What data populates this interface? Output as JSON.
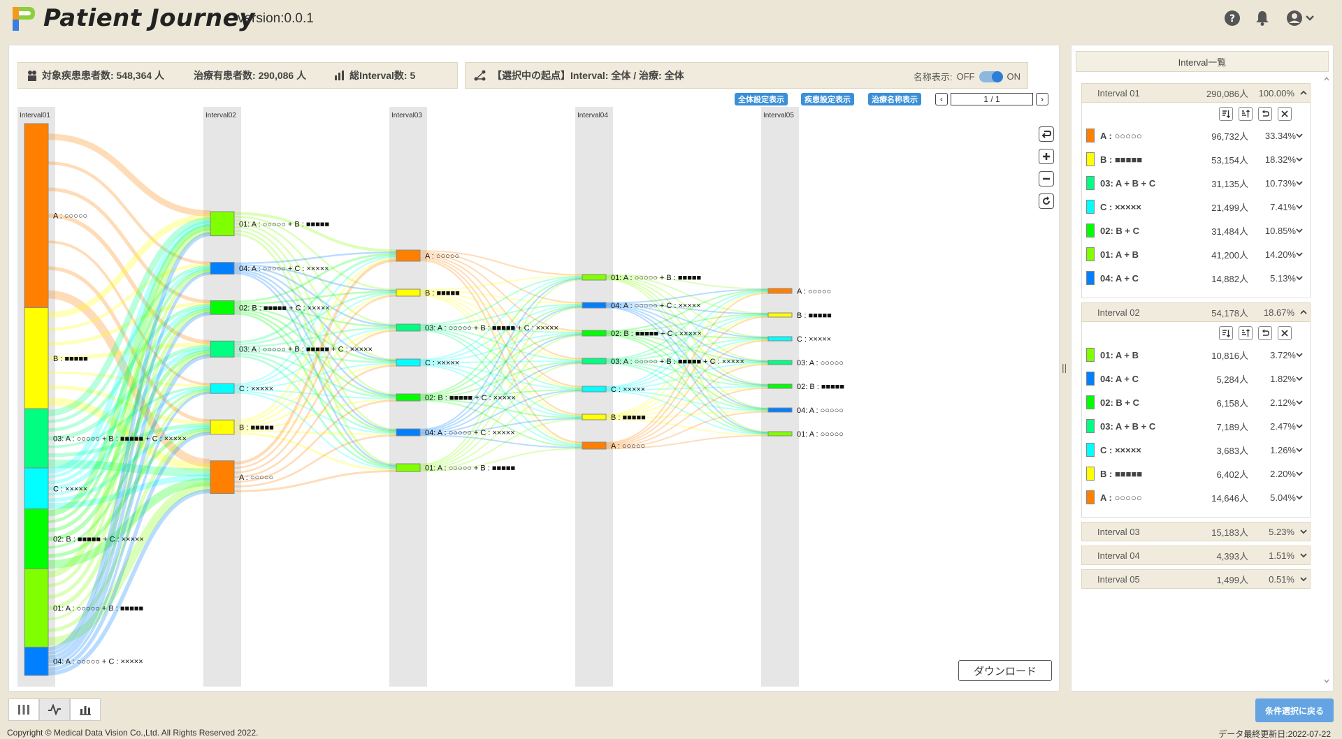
{
  "header": {
    "title": "Patient Journey",
    "version": "version:0.0.1"
  },
  "stats": {
    "target_patients": "対象疾患患者数: 548,364 人",
    "treated_patients": "治療有患者数: 290,086 人",
    "total_intervals": "総Interval数: 5"
  },
  "origin": {
    "text": "【選択中の起点】Interval: 全体 / 治療: 全体",
    "name_display_label": "名称表示:",
    "off_label": "OFF",
    "on_label": "ON"
  },
  "toolbar": {
    "overall_settings": "全体設定表示",
    "disease_settings": "疾患設定表示",
    "treatment_names": "治療名称表示",
    "page": "1 / 1",
    "download": "ダウンロード"
  },
  "colors": {
    "A": "#ff8000",
    "B": "#ffff00",
    "ABC": "#00ff80",
    "C": "#00ffff",
    "BC": "#00ff00",
    "AB": "#80ff00",
    "AC": "#0080ff"
  },
  "sankey": {
    "columns": [
      "Interval01",
      "Interval02",
      "Interval03",
      "Interval04",
      "Interval05"
    ],
    "columns_nodes": [
      [
        {
          "key": "A",
          "label": "A : ○○○○○"
        },
        {
          "key": "B",
          "label": "B : ■■■■■"
        },
        {
          "key": "ABC",
          "label": "03: A : ○○○○○ + B : ■■■■■ + C : ×××××"
        },
        {
          "key": "C",
          "label": "C : ×××××"
        },
        {
          "key": "BC",
          "label": "02: B : ■■■■■ + C : ×××××"
        },
        {
          "key": "AB",
          "label": "01: A : ○○○○○ + B : ■■■■■"
        },
        {
          "key": "AC",
          "label": "04: A : ○○○○○ + C : ×××××"
        }
      ],
      [
        {
          "key": "AB",
          "label": "01: A : ○○○○○ + B : ■■■■■"
        },
        {
          "key": "AC",
          "label": "04: A : ○○○○○ + C : ×××××"
        },
        {
          "key": "BC",
          "label": "02: B : ■■■■■ + C : ×××××"
        },
        {
          "key": "ABC",
          "label": "03: A : ○○○○○ + B : ■■■■■ + C : ×××××"
        },
        {
          "key": "C",
          "label": "C : ×××××"
        },
        {
          "key": "B",
          "label": "B : ■■■■■"
        },
        {
          "key": "A",
          "label": "A : ○○○○○"
        }
      ],
      [
        {
          "key": "A",
          "label": "A : ○○○○○"
        },
        {
          "key": "B",
          "label": "B : ■■■■■"
        },
        {
          "key": "ABC",
          "label": "03: A : ○○○○○ + B : ■■■■■ + C : ×××××"
        },
        {
          "key": "C",
          "label": "C : ×××××"
        },
        {
          "key": "BC",
          "label": "02: B : ■■■■■ + C : ×××××"
        },
        {
          "key": "AC",
          "label": "04: A : ○○○○○ + C : ×××××"
        },
        {
          "key": "AB",
          "label": "01: A : ○○○○○ + B : ■■■■■"
        }
      ],
      [
        {
          "key": "AB",
          "label": "01: A : ○○○○○ + B : ■■■■■"
        },
        {
          "key": "AC",
          "label": "04: A : ○○○○○ + C : ×××××"
        },
        {
          "key": "BC",
          "label": "02: B : ■■■■■ + C : ×××××"
        },
        {
          "key": "ABC",
          "label": "03: A : ○○○○○ + B : ■■■■■ + C : ×××××"
        },
        {
          "key": "C",
          "label": "C : ×××××"
        },
        {
          "key": "B",
          "label": "B : ■■■■■"
        },
        {
          "key": "A",
          "label": "A : ○○○○○"
        }
      ],
      [
        {
          "key": "A",
          "label": "A : ○○○○○"
        },
        {
          "key": "B",
          "label": "B : ■■■■■"
        },
        {
          "key": "C",
          "label": "C : ×××××"
        },
        {
          "key": "ABC",
          "label": "03: A : ○○○○○"
        },
        {
          "key": "BC",
          "label": "02: B : ■■■■■"
        },
        {
          "key": "AC",
          "label": "04: A : ○○○○○"
        },
        {
          "key": "AB",
          "label": "01: A : ○○○○○"
        }
      ]
    ]
  },
  "right_panel": {
    "title": "Interval一覧",
    "intervals": [
      {
        "name": "Interval 01",
        "count": "290,086人",
        "pct": "100.00%",
        "expanded": true,
        "rows": [
          {
            "key": "A",
            "label": "A : ○○○○○",
            "count": "96,732人",
            "pct": "33.34%"
          },
          {
            "key": "B",
            "label": "B : ■■■■■",
            "count": "53,154人",
            "pct": "18.32%"
          },
          {
            "key": "ABC",
            "label": "03: A + B + C",
            "count": "31,135人",
            "pct": "10.73%"
          },
          {
            "key": "C",
            "label": "C : ×××××",
            "count": "21,499人",
            "pct": "7.41%"
          },
          {
            "key": "BC",
            "label": "02: B + C",
            "count": "31,484人",
            "pct": "10.85%"
          },
          {
            "key": "AB",
            "label": "01: A + B",
            "count": "41,200人",
            "pct": "14.20%"
          },
          {
            "key": "AC",
            "label": "04: A + C",
            "count": "14,882人",
            "pct": "5.13%"
          }
        ]
      },
      {
        "name": "Interval 02",
        "count": "54,178人",
        "pct": "18.67%",
        "expanded": true,
        "rows": [
          {
            "key": "AB",
            "label": "01: A + B",
            "count": "10,816人",
            "pct": "3.72%"
          },
          {
            "key": "AC",
            "label": "04: A + C",
            "count": "5,284人",
            "pct": "1.82%"
          },
          {
            "key": "BC",
            "label": "02: B + C",
            "count": "6,158人",
            "pct": "2.12%"
          },
          {
            "key": "ABC",
            "label": "03: A + B + C",
            "count": "7,189人",
            "pct": "2.47%"
          },
          {
            "key": "C",
            "label": "C : ×××××",
            "count": "3,683人",
            "pct": "1.26%"
          },
          {
            "key": "B",
            "label": "B : ■■■■■",
            "count": "6,402人",
            "pct": "2.20%"
          },
          {
            "key": "A",
            "label": "A : ○○○○○",
            "count": "14,646人",
            "pct": "5.04%"
          }
        ]
      },
      {
        "name": "Interval 03",
        "count": "15,183人",
        "pct": "5.23%",
        "expanded": false,
        "rows": []
      },
      {
        "name": "Interval 04",
        "count": "4,393人",
        "pct": "1.51%",
        "expanded": false,
        "rows": []
      },
      {
        "name": "Interval 05",
        "count": "1,499人",
        "pct": "0.51%",
        "expanded": false,
        "rows": []
      }
    ]
  },
  "footer": {
    "back_button": "条件選択に戻る",
    "copyright": "Copyright © Medical Data Vision Co.,Ltd. All Rights Reserved 2022.",
    "last_updated": "データ最終更新日:2022-07-22"
  }
}
